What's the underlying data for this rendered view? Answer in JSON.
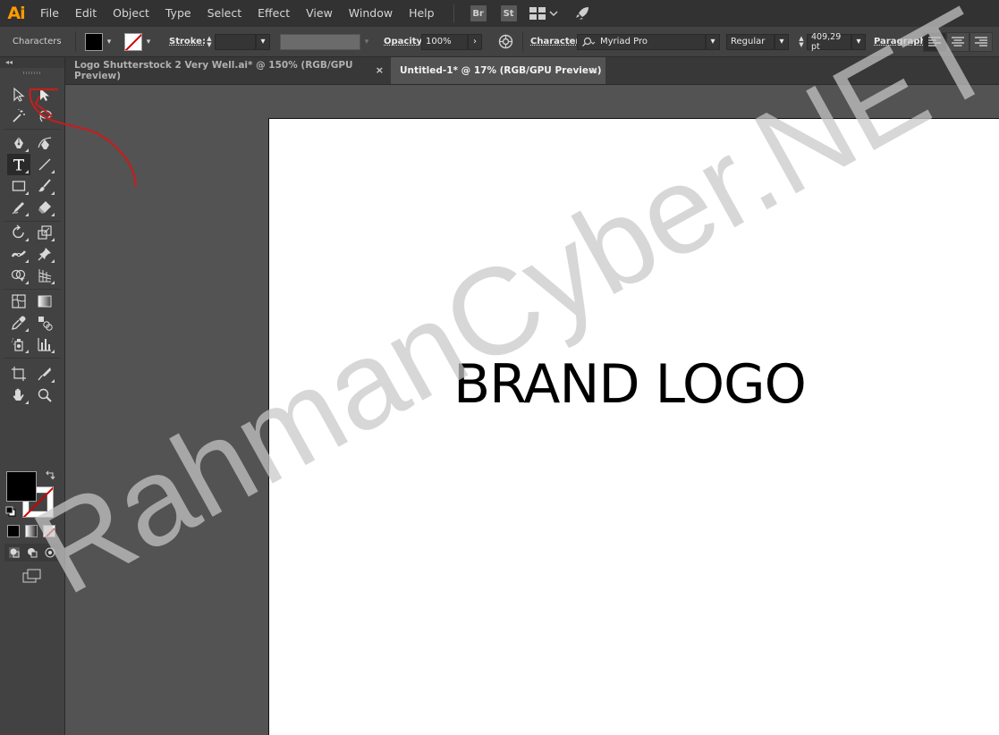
{
  "app": {
    "logo": "Ai"
  },
  "menu": {
    "items": [
      "File",
      "Edit",
      "Object",
      "Type",
      "Select",
      "Effect",
      "View",
      "Window",
      "Help"
    ],
    "bridge": "Br",
    "stock": "St"
  },
  "control_bar": {
    "panel_name": "Characters",
    "stroke_label": "Stroke:",
    "opacity_label": "Opacity:",
    "opacity_value": "100%",
    "character_label": "Character:",
    "font_family": "Myriad Pro",
    "font_style": "Regular",
    "font_size": "409,29 pt",
    "paragraph_label": "Paragraph:"
  },
  "tabs": [
    {
      "label": "Logo Shutterstock 2 Very Well.ai* @ 150% (RGB/GPU Preview)",
      "close": "×",
      "active": false
    },
    {
      "label": "Untitled-1* @ 17% (RGB/GPU Preview)",
      "close": "×",
      "active": true
    }
  ],
  "artboard": {
    "text": "BRAND LOGO"
  },
  "watermark": {
    "text": "RahmanCyber.NET"
  },
  "colors": {
    "menubar": "#323232",
    "toolbar": "#424242",
    "canvas": "#535353",
    "accent_logo": "#ff9a00",
    "annotation": "#c0201f"
  },
  "tools": [
    "selection-tool",
    "direct-selection-tool",
    "magic-wand-tool",
    "lasso-tool",
    "pen-tool",
    "curvature-tool",
    "type-tool",
    "line-segment-tool",
    "rectangle-tool",
    "paintbrush-tool",
    "shaper-tool",
    "eraser-tool",
    "rotate-tool",
    "scale-tool",
    "width-tool",
    "puppet-warp-tool",
    "shape-builder-tool",
    "perspective-grid-tool",
    "mesh-tool",
    "gradient-tool",
    "eyedropper-tool",
    "blend-tool",
    "symbol-sprayer-tool",
    "column-graph-tool",
    "artboard-tool",
    "slice-tool",
    "hand-tool",
    "zoom-tool"
  ]
}
